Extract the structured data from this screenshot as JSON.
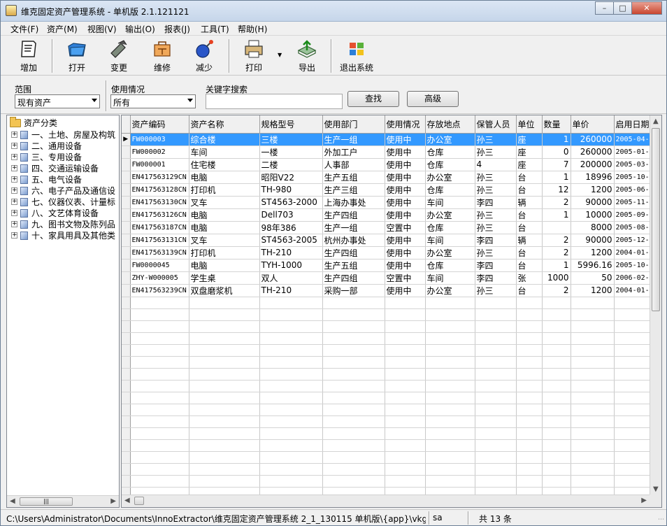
{
  "window": {
    "title": "维克固定资产管理系统 - 单机版 2.1.121121",
    "controls": [
      "minimize",
      "maximize",
      "close"
    ]
  },
  "menu": [
    "文件(F)",
    "资产(M)",
    "视图(V)",
    "输出(O)",
    "报表(J)",
    "工具(T)",
    "帮助(H)"
  ],
  "toolbar": [
    {
      "label": "增加",
      "icon": "add-document-icon"
    },
    {
      "label": "打开",
      "icon": "open-folder-icon"
    },
    {
      "label": "变更",
      "icon": "change-hammer-icon"
    },
    {
      "label": "维修",
      "icon": "repair-toolbox-icon"
    },
    {
      "label": "减少",
      "icon": "reduce-bomb-icon"
    },
    {
      "label": "打印",
      "icon": "printer-icon"
    },
    {
      "label": "导出",
      "icon": "export-arrow-icon"
    },
    {
      "label": "退出系统",
      "icon": "exit-windows-icon"
    }
  ],
  "filters": {
    "scope_label": "范围",
    "scope_value": "现有资产",
    "usage_label": "使用情况",
    "usage_value": "所有",
    "keyword_label": "关键字搜索",
    "keyword_value": "",
    "search_button": "查找",
    "advanced_button": "高级"
  },
  "tree": {
    "root": "资产分类",
    "items": [
      "一、土地、房屋及构筑",
      "二、通用设备",
      "三、专用设备",
      "四、交通运输设备",
      "五、电气设备",
      "六、电子产品及通信设",
      "七、仪器仪表、计量标",
      "八、文艺体育设备",
      "九、图书文物及陈列品",
      "十、家具用具及其他类"
    ]
  },
  "grid": {
    "columns": [
      "资产编码",
      "资产名称",
      "规格型号",
      "使用部门",
      "使用情况",
      "存放地点",
      "保管人员",
      "单位",
      "数量",
      "单价",
      "启用日期"
    ],
    "rows": [
      [
        "FW000003",
        "综合楼",
        "三楼",
        "生产一组",
        "使用中",
        "办公室",
        "孙三",
        "座",
        "1",
        "260000",
        "2005-04-"
      ],
      [
        "FW000002",
        "车间",
        "一楼",
        "外加工户",
        "使用中",
        "仓库",
        "孙三",
        "座",
        "0",
        "260000",
        "2005-01-"
      ],
      [
        "FW000001",
        "住宅楼",
        "二楼",
        "人事部",
        "使用中",
        "仓库",
        "4",
        "座",
        "7",
        "200000",
        "2005-03-"
      ],
      [
        "EN417563129CN",
        "电脑",
        "昭阳V22",
        "生产五组",
        "使用中",
        "办公室",
        "孙三",
        "台",
        "1",
        "18996",
        "2005-10-"
      ],
      [
        "EN417563128CN",
        "打印机",
        "TH-980",
        "生产三组",
        "使用中",
        "仓库",
        "孙三",
        "台",
        "12",
        "1200",
        "2005-06-"
      ],
      [
        "EN417563130CN",
        "叉车",
        "ST4563-2000",
        "上海办事处",
        "使用中",
        "车间",
        "李四",
        "辆",
        "2",
        "90000",
        "2005-11-"
      ],
      [
        "EN417563126CN",
        "电脑",
        "Dell703",
        "生产四组",
        "使用中",
        "办公室",
        "孙三",
        "台",
        "1",
        "10000",
        "2005-09-"
      ],
      [
        "EN417563187CN",
        "电脑",
        "98年386",
        "生产一组",
        "空置中",
        "仓库",
        "孙三",
        "台",
        "",
        "8000",
        "2005-08-"
      ],
      [
        "EN417563131CN",
        "叉车",
        "ST4563-2005",
        "杭州办事处",
        "使用中",
        "车间",
        "李四",
        "辆",
        "2",
        "90000",
        "2005-12-"
      ],
      [
        "EN417563139CN",
        "打印机",
        "TH-210",
        "生产四组",
        "使用中",
        "办公室",
        "孙三",
        "台",
        "2",
        "1200",
        "2004-01-"
      ],
      [
        "FW0000045",
        "电脑",
        "TYH-1000",
        "生产五组",
        "使用中",
        "仓库",
        "李四",
        "台",
        "1",
        "5996.16",
        "2005-10-"
      ],
      [
        "ZHY-W000005",
        "学生桌",
        "双人",
        "生产四组",
        "空置中",
        "车间",
        "李四",
        "张",
        "1000",
        "50",
        "2006-02-"
      ],
      [
        "EN417563239CN",
        "双盘磨浆机",
        "TH-210",
        "采购一部",
        "使用中",
        "办公室",
        "孙三",
        "台",
        "2",
        "1200",
        "2004-01-"
      ]
    ],
    "selected_row": 0
  },
  "status": {
    "path": "C:\\Users\\Administrator\\Documents\\InnoExtractor\\维克固定资产管理系统 2_1_130115 单机版\\{app}\\vkgdzc.",
    "user": "sa",
    "count": "共 13 条"
  },
  "colors": {
    "selection": "#3399ff",
    "titlebar": "#c6d6ea",
    "close_button": "#c9462f"
  }
}
